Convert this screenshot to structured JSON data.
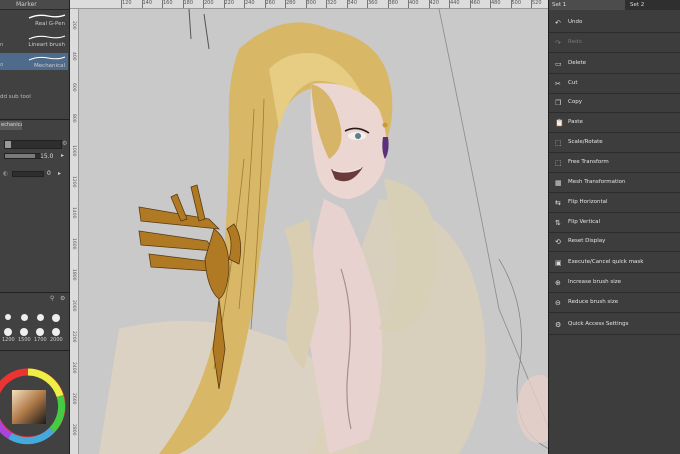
{
  "subtool": {
    "header": "Marker",
    "brushes": [
      {
        "label": "Real G-Pen",
        "selected": false
      },
      {
        "label": "Lineart brush",
        "selected": false
      },
      {
        "label": "Mechanical",
        "selected": true
      }
    ],
    "side_tabs": [
      "n",
      "o"
    ],
    "add_sub_tool": "dd sub tool"
  },
  "tool_property": {
    "tab": "echanical",
    "brush_size_value": "15.0",
    "opacity_value": "0"
  },
  "brush_size_palette": {
    "sizes": [
      "1200",
      "1500",
      "1700",
      "2000"
    ]
  },
  "canvas": {
    "ruler_top": [
      "120",
      "140",
      "160",
      "180",
      "200",
      "220",
      "240",
      "260",
      "280",
      "300",
      "320",
      "340",
      "360",
      "380",
      "400",
      "420",
      "440",
      "460",
      "480",
      "500",
      "520",
      "540",
      "560",
      "580",
      "600",
      "620",
      "640",
      "660",
      "680",
      "700",
      "720",
      "740",
      "760",
      "780"
    ],
    "ruler_left": [
      "200",
      "400",
      "600",
      "800",
      "1000",
      "1200",
      "1400",
      "1600",
      "1800",
      "2000",
      "2200",
      "2400",
      "2600",
      "2800"
    ]
  },
  "quick_access": {
    "tabs": [
      "Set 1",
      "Set 2"
    ],
    "items": [
      {
        "label": "Undo",
        "icon": "undo-icon",
        "disabled": false
      },
      {
        "label": "Redo",
        "icon": "redo-icon",
        "disabled": true
      },
      {
        "label": "Delete",
        "icon": "delete-icon",
        "disabled": false
      },
      {
        "label": "Cut",
        "icon": "cut-icon",
        "disabled": false
      },
      {
        "label": "Copy",
        "icon": "copy-icon",
        "disabled": false
      },
      {
        "label": "Paste",
        "icon": "paste-icon",
        "disabled": false
      },
      {
        "label": "Scale/Rotate",
        "icon": "scale-rotate-icon",
        "disabled": false
      },
      {
        "label": "Free Transform",
        "icon": "free-transform-icon",
        "disabled": false
      },
      {
        "label": "Mesh Transformation",
        "icon": "mesh-transform-icon",
        "disabled": false
      },
      {
        "label": "Flip Horizontal",
        "icon": "flip-horizontal-icon",
        "disabled": false
      },
      {
        "label": "Flip Vertical",
        "icon": "flip-vertical-icon",
        "disabled": false
      },
      {
        "label": "Reset Display",
        "icon": "reset-display-icon",
        "disabled": false
      },
      {
        "label": "Execute/Cancel quick mask",
        "icon": "quick-mask-icon",
        "disabled": false
      },
      {
        "label": "Increase brush size",
        "icon": "increase-brush-icon",
        "disabled": false
      },
      {
        "label": "Reduce brush size",
        "icon": "reduce-brush-icon",
        "disabled": false
      },
      {
        "label": "Quick Access Settings",
        "icon": "settings-icon",
        "disabled": false
      }
    ]
  },
  "colors": {
    "panel_bg": "#3d3d3d",
    "selected_row": "#4e6b8c",
    "canvas_bg": "#c9c9c9",
    "skin": "#e6d3cf",
    "hair": "#d9bb6e",
    "gold": "#b07a25"
  }
}
